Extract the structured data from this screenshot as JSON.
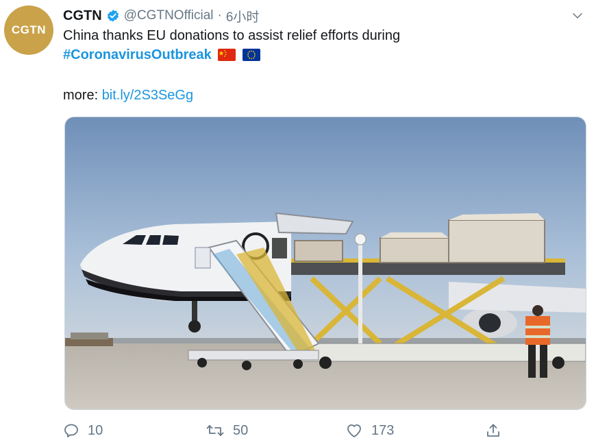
{
  "tweet": {
    "avatar_text": "CGTN",
    "author_name": "CGTN",
    "handle": "@CGTNOfficial",
    "separator": "·",
    "time": "6小时",
    "text_line1": "China thanks EU donations to assist relief efforts during",
    "hashtag": "#CoronavirusOutbreak",
    "flags": [
      "china-flag-icon",
      "eu-flag-icon"
    ],
    "more_label": "more: ",
    "link": "bit.ly/2S3SeGg"
  },
  "actions": {
    "reply_count": "10",
    "retweet_count": "50",
    "like_count": "173"
  },
  "colors": {
    "accent": "#1b95e0",
    "muted": "#657786",
    "avatar_bg": "#c9a24a"
  }
}
